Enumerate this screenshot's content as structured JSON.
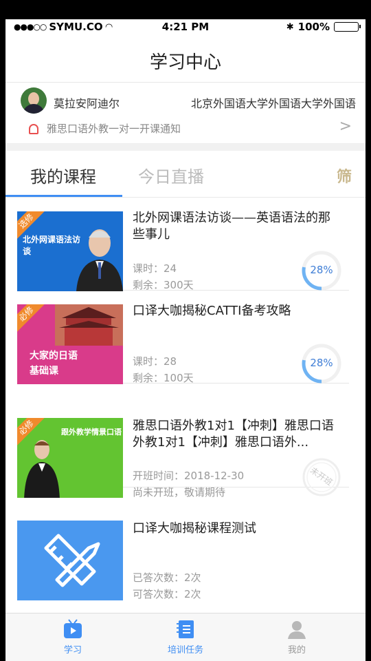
{
  "status_bar": {
    "carrier": "SYMU.CO",
    "time": "4:21 PM",
    "battery": "100%"
  },
  "nav": {
    "title": "学习中心"
  },
  "user": {
    "name": "莫拉安阿迪尔",
    "school": "北京外国语大学外国语大学外国语"
  },
  "notice": {
    "text": "雅思口语外教一对一开课通知"
  },
  "tabs": [
    {
      "label": "我的课程"
    },
    {
      "label": "今日直播"
    }
  ],
  "filter_label": "筛",
  "courses": [
    {
      "badge": "选修",
      "title": "北外网课语法访谈——英语语法的那些事儿",
      "thumb_text": "北外网课语法访谈",
      "meta1": "课时：24",
      "meta2": "剩余：300天",
      "progress": "28%",
      "progress_value": 28
    },
    {
      "badge": "必修",
      "title": "口译大咖揭秘CATTI备考攻略",
      "thumb_text1": "大家的日语",
      "thumb_text2": "基础课",
      "meta1": "课时：28",
      "meta2": "剩余：100天",
      "progress": "28%",
      "progress_value": 28
    },
    {
      "badge": "必修",
      "title": "雅思口语外教1对1【冲刺】雅思口语外教1对1【冲刺】雅思口语外...",
      "thumb_text": "跟外教学情景口语",
      "meta1": "开班时间：2018-12-30",
      "meta2": "尚未开班，敬请期待",
      "stamp": "未开班"
    },
    {
      "title": "口译大咖揭秘课程测试",
      "meta1": "已答次数：2次",
      "meta2": "可答次数：2次"
    }
  ],
  "tabbar": [
    {
      "label": "学习",
      "icon": "tv-icon"
    },
    {
      "label": "培训任务",
      "icon": "notebook-icon"
    },
    {
      "label": "我的",
      "icon": "person-icon"
    }
  ],
  "colors": {
    "accent": "#3f8ef3",
    "text": "#222222",
    "muted": "#999999",
    "progress_ring": "#6fb3f3"
  }
}
